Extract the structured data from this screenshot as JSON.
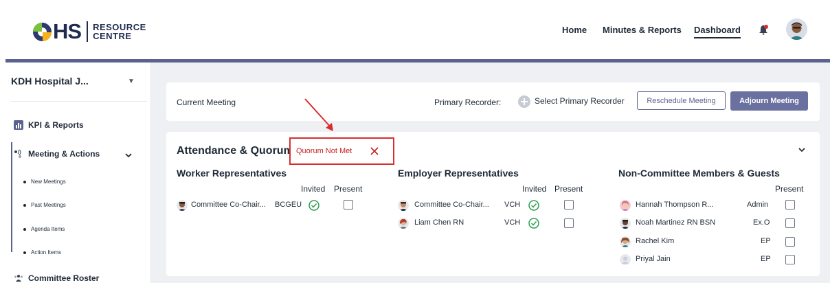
{
  "header": {
    "logo_main": "HS",
    "logo_sub_line1": "RESOURCE",
    "logo_sub_line2": "CENTRE",
    "nav": [
      {
        "label": "Home"
      },
      {
        "label": "Minutes & Reports"
      },
      {
        "label": "Dashboard",
        "active": true
      }
    ],
    "icons": [
      "bell-icon",
      "user-avatar"
    ]
  },
  "sidebar": {
    "org_name": "KDH Hospital J...",
    "items": [
      {
        "label": "KPI & Reports",
        "icon": "bar-chart-icon"
      },
      {
        "label": "Meeting & Actions",
        "icon": "meeting-icon",
        "expanded": true
      },
      {
        "label": "Committee Roster",
        "icon": "people-icon"
      }
    ],
    "sub_items": [
      {
        "label": "New Meetings"
      },
      {
        "label": "Past Meetings"
      },
      {
        "label": "Agenda Items"
      },
      {
        "label": "Action Items"
      }
    ]
  },
  "current_meeting": {
    "label": "Current Meeting",
    "primary_recorder_label": "Primary Recorder:",
    "select_recorder": "Select Primary Recorder",
    "reschedule_button": "Reschedule Meeting",
    "adjourn_button": "Adjourn Meeting"
  },
  "attendance": {
    "title": "Attendance & Quorum",
    "quorum_status": "Quorum Not Met",
    "worker": {
      "title": "Worker Representatives",
      "col_invited": "Invited",
      "col_present": "Present",
      "members": [
        {
          "name": "Committee Co-Chair...",
          "org": "BCGEU",
          "invited": true,
          "present": false
        }
      ]
    },
    "employer": {
      "title": "Employer Representatives",
      "col_invited": "Invited",
      "col_present": "Present",
      "members": [
        {
          "name": "Committee Co-Chair...",
          "org": "VCH",
          "invited": true,
          "present": false
        },
        {
          "name": "Liam Chen RN",
          "org": "VCH",
          "invited": true,
          "present": false
        }
      ]
    },
    "guests": {
      "title": "Non-Committee Members & Guests",
      "col_present": "Present",
      "members": [
        {
          "name": "Hannah Thompson R...",
          "role": "Admin",
          "present": false
        },
        {
          "name": "Noah Martinez RN BSN",
          "role": "Ex.O",
          "present": false
        },
        {
          "name": "Rachel Kim",
          "role": "EP",
          "present": false
        },
        {
          "name": "Priyal Jain",
          "role": "EP",
          "present": false
        }
      ]
    }
  },
  "colors": {
    "accent": "#5b6290",
    "success": "#2e9e4f",
    "alert": "#d92d2d"
  }
}
